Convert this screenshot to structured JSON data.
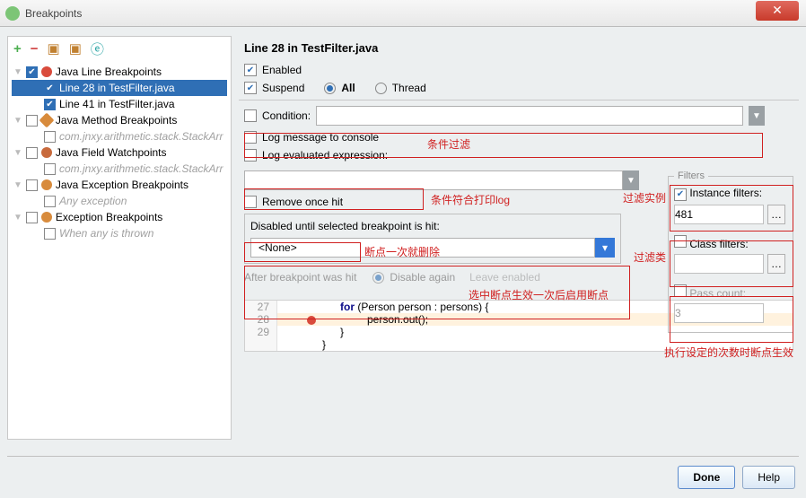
{
  "window": {
    "title": "Breakpoints"
  },
  "header": "Line 28 in TestFilter.java",
  "tree": {
    "g1": {
      "label": "Java Line Breakpoints",
      "items": [
        {
          "label": "Line 28 in TestFilter.java",
          "checked": true,
          "selected": true
        },
        {
          "label": "Line 41 in TestFilter.java",
          "checked": true,
          "selected": false
        }
      ]
    },
    "g2": {
      "label": "Java Method Breakpoints",
      "items": [
        {
          "label": "com.jnxy.arithmetic.stack.StackArr"
        }
      ]
    },
    "g3": {
      "label": "Java Field Watchpoints",
      "items": [
        {
          "label": "com.jnxy.arithmetic.stack.StackArr"
        }
      ]
    },
    "g4": {
      "label": "Java Exception Breakpoints",
      "items": [
        {
          "label": "Any exception"
        }
      ]
    },
    "g5": {
      "label": "Exception Breakpoints",
      "items": [
        {
          "label": "When any is thrown"
        }
      ]
    }
  },
  "opts": {
    "enabled": "Enabled",
    "suspend": "Suspend",
    "all": "All",
    "thread": "Thread",
    "condition": "Condition:",
    "logmsg": "Log message to console",
    "logexpr": "Log evaluated expression:",
    "removeonce": "Remove once hit",
    "disableduntil": "Disabled until selected breakpoint is hit:",
    "none": "<None>",
    "afterhit": "After breakpoint was hit",
    "disableagain": "Disable again",
    "leave": "Leave enabled"
  },
  "filters": {
    "legend": "Filters",
    "instance": "Instance filters:",
    "instance_val": "481",
    "class": "Class filters:",
    "pass": "Pass count:",
    "pass_val": "3"
  },
  "anno": {
    "cond": "条件过滤",
    "expr": "条件符合打印log",
    "remove": "断点一次就删除",
    "disable": "选中断点生效一次后启用断点",
    "inst": "过滤实例",
    "cls": "过滤类",
    "pass": "执行设定的次数时断点生效"
  },
  "code": {
    "l27": {
      "n": "27",
      "t": "for (Person person : persons) {"
    },
    "l28": {
      "n": "28",
      "t": "person.out();"
    },
    "l29": {
      "n": "29",
      "t": "}"
    },
    "l30": {
      "n": "",
      "t": "}"
    }
  },
  "buttons": {
    "done": "Done",
    "help": "Help"
  }
}
